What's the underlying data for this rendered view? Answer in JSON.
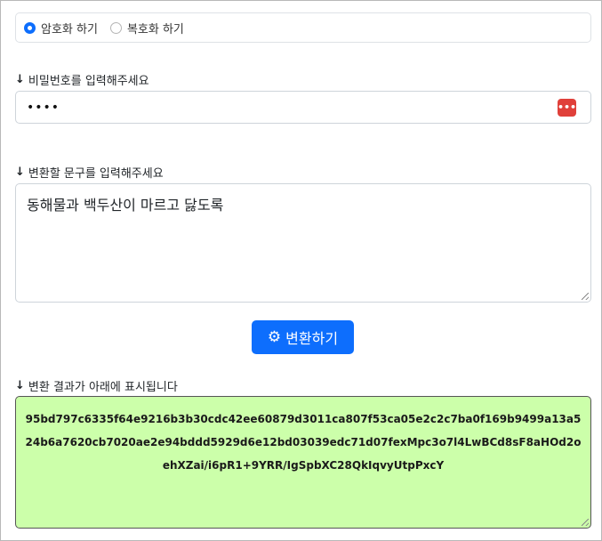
{
  "mode": {
    "options": [
      {
        "label": "암호화 하기",
        "checked": true
      },
      {
        "label": "복호화 하기",
        "checked": false
      }
    ]
  },
  "password": {
    "label": "비밀번호를 입력해주세요",
    "value": "••••",
    "manager_icon": "password-manager-icon",
    "manager_glyph": "•••|"
  },
  "input_text": {
    "label": "변환할 문구를 입력해주세요",
    "value": "동해물과 백두산이 마르고 닳도록"
  },
  "convert_button": {
    "label": "변환하기",
    "icon": "gears-icon",
    "color": "#0d6efd"
  },
  "result": {
    "label": "변환 결과가 아래에 표시됩니다",
    "value": "95bd797c6335f64e9216b3b30cdc42ee60879d3011ca807f53ca05e2c2c7ba0f169b9499a13a524b6a7620cb7020ae2e94bddd5929d6e12bd03039edc71d07fexMpc3o7l4LwBCd8sF8aHOd2oehXZai/i6pR1+9YRR/IgSpbXC28QkIqvyUtpPxcY",
    "background": "#ccffaa"
  },
  "arrow_glyph": "🡓"
}
